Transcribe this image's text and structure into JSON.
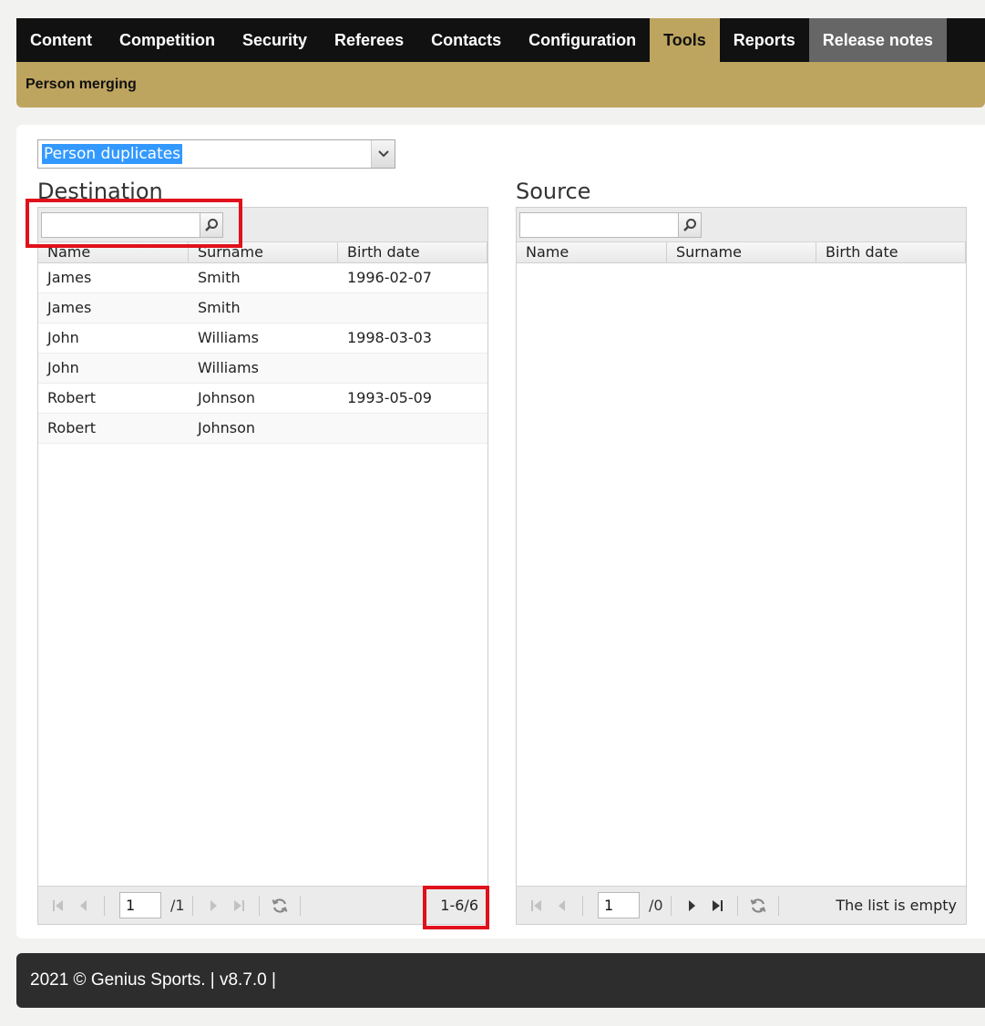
{
  "nav": {
    "tabs": [
      "Content",
      "Competition",
      "Security",
      "Referees",
      "Contacts",
      "Configuration",
      "Tools",
      "Reports",
      "Release notes"
    ],
    "active": "Tools"
  },
  "subnav": {
    "item": "Person merging"
  },
  "selector": {
    "value": "Person duplicates"
  },
  "destination": {
    "title": "Destination",
    "columns": [
      "Name",
      "Surname",
      "Birth date"
    ],
    "rows": [
      [
        "James",
        "Smith",
        "1996-02-07"
      ],
      [
        "James",
        "Smith",
        ""
      ],
      [
        "John",
        "Williams",
        "1998-03-03"
      ],
      [
        "John",
        "Williams",
        ""
      ],
      [
        "Robert",
        "Johnson",
        "1993-05-09"
      ],
      [
        "Robert",
        "Johnson",
        ""
      ]
    ],
    "pager": {
      "page": "1",
      "total": "/1",
      "info": "1-6/6"
    }
  },
  "source": {
    "title": "Source",
    "columns": [
      "Name",
      "Surname",
      "Birth date"
    ],
    "rows": [],
    "pager": {
      "page": "1",
      "total": "/0",
      "info": "The list is empty"
    }
  },
  "footer": {
    "text": "2021 © Genius Sports. | v8.7.0 |"
  },
  "colors": {
    "accent": "#bea55f",
    "highlight": "#e0111c"
  }
}
